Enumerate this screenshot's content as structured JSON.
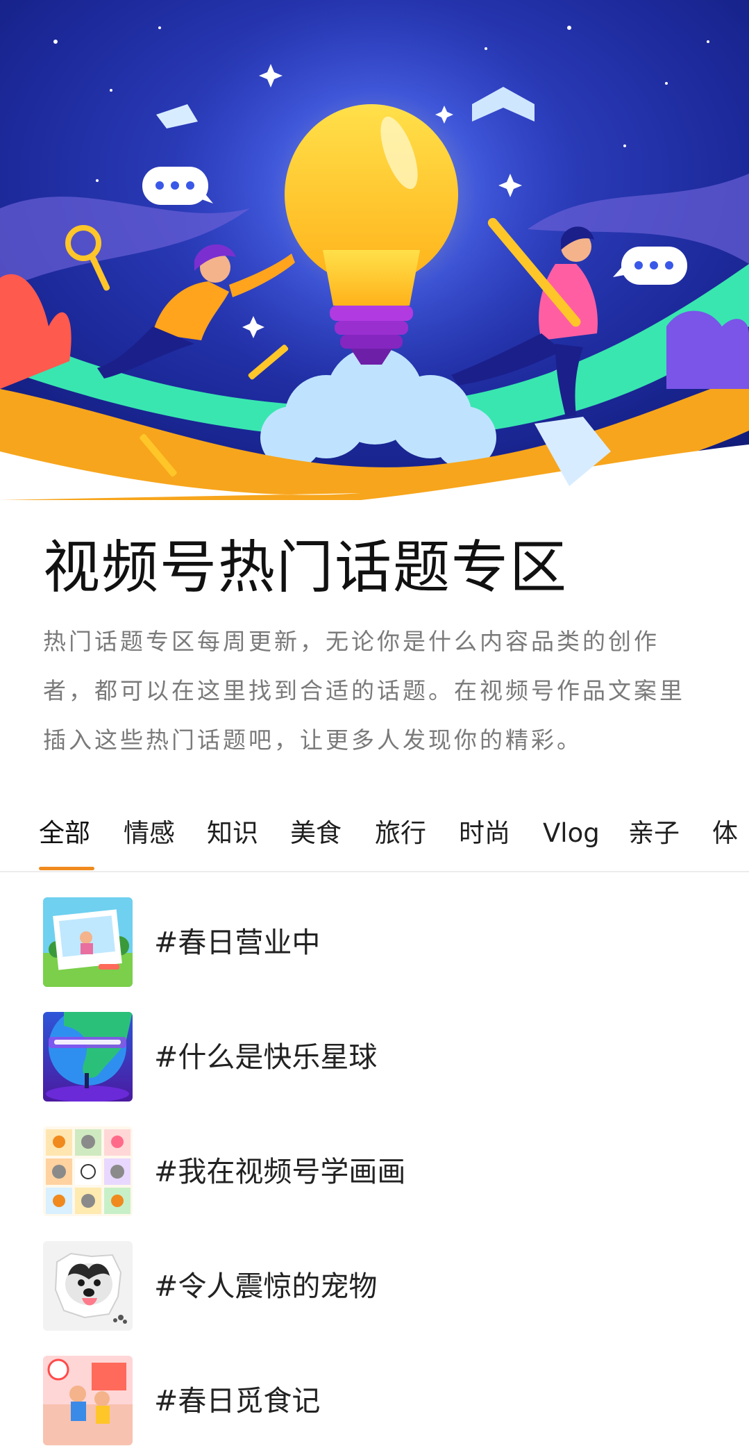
{
  "banner": {
    "illustration": "lightbulb-creators-banner",
    "colors": {
      "sky": "#1d2a9c",
      "bulb": "#ffc629",
      "wave_green": "#39e6b0",
      "wave_orange": "#f7a51c"
    }
  },
  "page": {
    "title": "视频号热门话题专区",
    "description": "热门话题专区每周更新，无论你是什么内容品类的创作者，都可以在这里找到合适的话题。在视频号作品文案里插入这些热门话题吧，让更多人发现你的精彩。"
  },
  "tabs": {
    "active_index": 0,
    "accent_color": "#f08a1e",
    "items": [
      {
        "label": "全部"
      },
      {
        "label": "情感"
      },
      {
        "label": "知识"
      },
      {
        "label": "美食"
      },
      {
        "label": "旅行"
      },
      {
        "label": "时尚"
      },
      {
        "label": "Vlog"
      },
      {
        "label": "亲子"
      },
      {
        "label": "体"
      }
    ]
  },
  "topics": [
    {
      "label": "#春日营业中",
      "thumb_icon": "spring-photo-thumbnail"
    },
    {
      "label": "#什么是快乐星球",
      "thumb_icon": "happy-planet-thumbnail"
    },
    {
      "label": "#我在视频号学画画",
      "thumb_icon": "cartoon-drawings-thumbnail"
    },
    {
      "label": "#令人震惊的宠物",
      "thumb_icon": "dog-thumbnail"
    },
    {
      "label": "#春日觅食记",
      "thumb_icon": "food-journey-thumbnail"
    }
  ]
}
